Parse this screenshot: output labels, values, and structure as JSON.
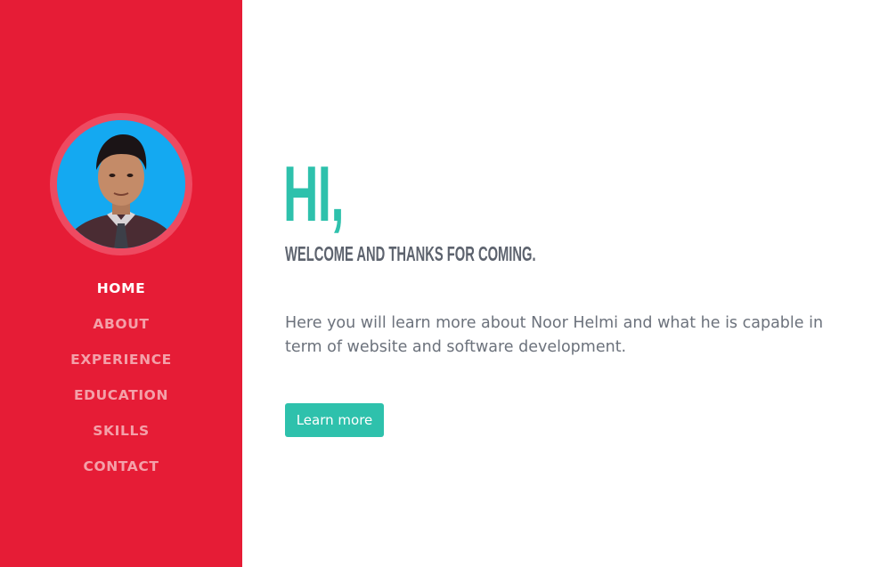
{
  "sidebar": {
    "avatar_alt": "Noor Helmi",
    "nav_items": [
      {
        "label": "HOME",
        "active": true
      },
      {
        "label": "ABOUT",
        "active": false
      },
      {
        "label": "EXPERIENCE",
        "active": false
      },
      {
        "label": "EDUCATION",
        "active": false
      },
      {
        "label": "SKILLS",
        "active": false
      },
      {
        "label": "CONTACT",
        "active": false
      }
    ]
  },
  "hero": {
    "greeting": "HI,",
    "subtitle": "WELCOME AND THANKS FOR COMING.",
    "intro": "Here you will learn more about Noor Helmi and what he is capable in term of website and software development.",
    "cta_label": "Learn more"
  },
  "colors": {
    "sidebar_bg": "#e61c36",
    "accent": "#2ec1ac",
    "nav_inactive": "#f4a0a9",
    "nav_active": "#ffffff",
    "text_muted": "#6c727c"
  }
}
